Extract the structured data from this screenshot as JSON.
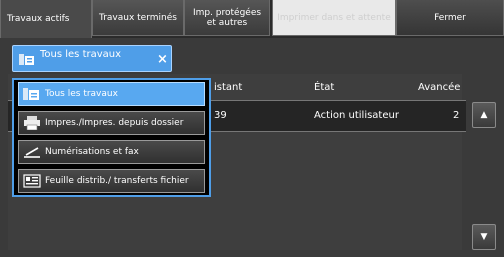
{
  "tabs": [
    {
      "label": "Travaux actifs"
    },
    {
      "label": "Travaux terminés"
    },
    {
      "label": "Imp. protégées et autres"
    },
    {
      "label": "Imprimer dans et attente"
    },
    {
      "label": "Fermer"
    }
  ],
  "filter": {
    "label": "Tous les travaux",
    "clear_icon": "×",
    "icon": "all-jobs-icon"
  },
  "menu": {
    "items": [
      {
        "label": "Tous les travaux",
        "icon": "all-jobs-icon",
        "selected": true
      },
      {
        "label": "Impres./Impres. depuis dossier",
        "icon": "printer-icon",
        "selected": false
      },
      {
        "label": "Numérisations et fax",
        "icon": "scan-icon",
        "selected": false
      },
      {
        "label": "Feuille distrib./ transferts fichier",
        "icon": "job-flow-icon",
        "selected": false
      }
    ]
  },
  "table": {
    "columns": [
      "istant",
      "État",
      "Avancée"
    ],
    "rows": [
      {
        "id": "39",
        "state": "Action utilisateur",
        "progress": "2"
      }
    ]
  },
  "scroll": {
    "up_icon": "▲",
    "down_icon": "▼"
  },
  "colors": {
    "accent": "#4f9ee8",
    "selected": "#58a8f0"
  }
}
